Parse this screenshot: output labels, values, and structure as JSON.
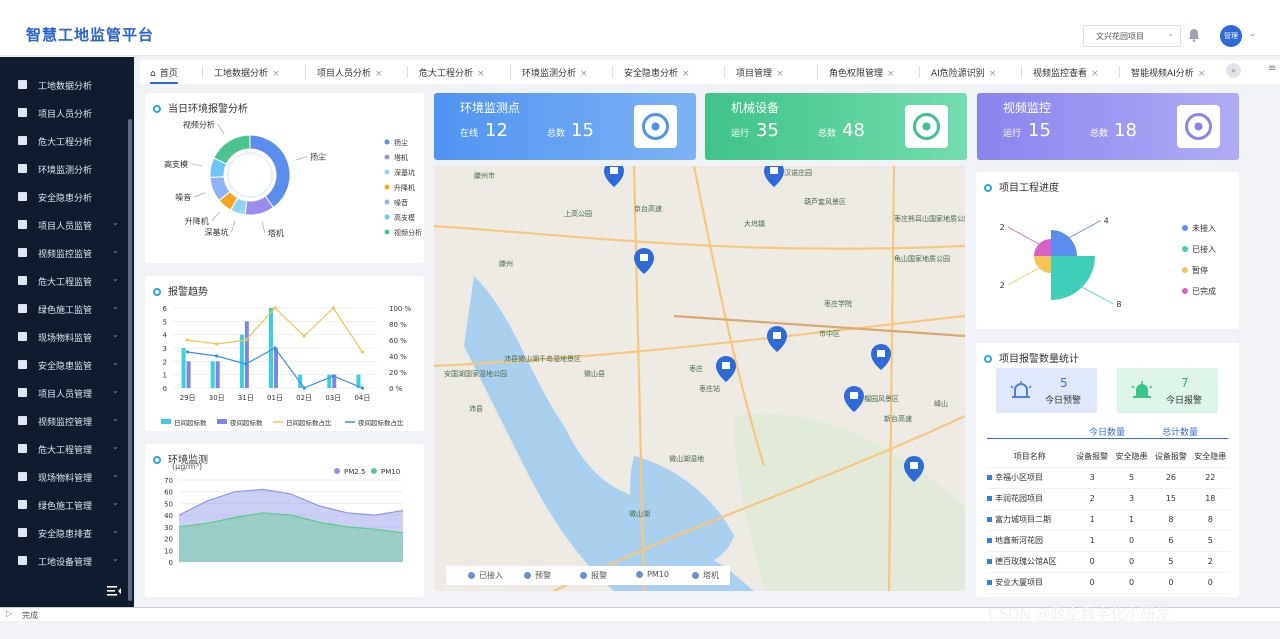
{
  "header": {
    "title": "智慧工地监管平台",
    "project_select": "文兴花园项目",
    "user": "管理"
  },
  "sidebar": {
    "items": [
      {
        "label": "工地数据分析",
        "expandable": false
      },
      {
        "label": "项目人员分析",
        "expandable": false
      },
      {
        "label": "危大工程分析",
        "expandable": false
      },
      {
        "label": "环境监测分析",
        "expandable": false
      },
      {
        "label": "安全隐患分析",
        "expandable": false
      },
      {
        "label": "项目人员监管",
        "expandable": true
      },
      {
        "label": "视频监控监管",
        "expandable": true
      },
      {
        "label": "危大工程监管",
        "expandable": true
      },
      {
        "label": "绿色施工监管",
        "expandable": true
      },
      {
        "label": "现场物料监管",
        "expandable": true
      },
      {
        "label": "安全隐患监管",
        "expandable": true
      },
      {
        "label": "项目人员管理",
        "expandable": true
      },
      {
        "label": "视频监控管理",
        "expandable": true
      },
      {
        "label": "危大工程管理",
        "expandable": true
      },
      {
        "label": "现场物料管理",
        "expandable": true
      },
      {
        "label": "绿色施工管理",
        "expandable": true
      },
      {
        "label": "安全隐患排查",
        "expandable": true
      },
      {
        "label": "工地设备管理",
        "expandable": true
      }
    ]
  },
  "tabs": [
    {
      "label": "首页",
      "active": true
    },
    {
      "label": "工地数据分析"
    },
    {
      "label": "项目人员分析"
    },
    {
      "label": "危大工程分析"
    },
    {
      "label": "环境监测分析"
    },
    {
      "label": "安全隐患分析"
    },
    {
      "label": "项目管理"
    },
    {
      "label": "角色权限管理"
    },
    {
      "label": "AI危险源识别"
    },
    {
      "label": "视频监控查看"
    },
    {
      "label": "智能视频AI分析"
    }
  ],
  "tab_more": "»",
  "alarm_analysis": {
    "title": "当日环境报警分析",
    "chart_data": {
      "type": "pie",
      "categories": [
        "扬尘",
        "塔机",
        "深基坑",
        "升降机",
        "噪音",
        "高支模",
        "视频分析"
      ],
      "values": [
        40,
        12,
        6,
        6,
        10,
        8,
        18
      ],
      "colors": [
        "#5b8def",
        "#9b8cf0",
        "#8fd3f5",
        "#f5a623",
        "#8fb3f7",
        "#6ec4f5",
        "#4cc48f"
      ]
    }
  },
  "alarm_trend": {
    "title": "报警趋势",
    "chart_data": {
      "type": "bar",
      "categories": [
        "29日",
        "30日",
        "31日",
        "01日",
        "02日",
        "03日",
        "04日"
      ],
      "yticks_left": [
        "0",
        "1",
        "2",
        "3",
        "4",
        "5",
        "6"
      ],
      "yticks_right": [
        "0 %",
        "20 %",
        "40 %",
        "60 %",
        "80 %",
        "100 %"
      ],
      "ylim": [
        0,
        6
      ],
      "series": [
        {
          "name": "日间超标数",
          "values": [
            3,
            2,
            4,
            6,
            1,
            1,
            1
          ],
          "color": "#3bd0e0"
        },
        {
          "name": "夜间超标数",
          "values": [
            2,
            2,
            5,
            3,
            0,
            1,
            0
          ],
          "color": "#7b87e8"
        },
        {
          "name": "日间超标数占比",
          "values": [
            60,
            55,
            60,
            100,
            65,
            100,
            45
          ],
          "color": "#f5c451",
          "axis": "right"
        },
        {
          "name": "夜间超标数占比",
          "values": [
            45,
            40,
            30,
            50,
            0,
            15,
            0
          ],
          "color": "#3b8ee8",
          "axis": "right"
        }
      ]
    }
  },
  "env_monitor": {
    "title": "环境监测",
    "unit": "(μg/m³)",
    "chart_data": {
      "type": "area",
      "x": [
        0,
        1,
        2,
        3,
        4,
        5,
        6,
        7,
        8
      ],
      "yticks": [
        "0",
        "10",
        "20",
        "30",
        "40",
        "50",
        "60",
        "70"
      ],
      "ylim": [
        0,
        70
      ],
      "series": [
        {
          "name": "PM2.5",
          "values": [
            40,
            52,
            60,
            62,
            58,
            48,
            42,
            40,
            44
          ],
          "color": "#8f94e8"
        },
        {
          "name": "PM10",
          "values": [
            30,
            33,
            38,
            42,
            40,
            34,
            30,
            28,
            25
          ],
          "color": "#5cc98f"
        }
      ]
    }
  },
  "cards": [
    {
      "title": "环境监测点",
      "k1": "在线",
      "v1": "12",
      "k2": "总数",
      "v2": "15",
      "color": "#4f93f0",
      "color2": "#7db3f5",
      "icon": "leaf-icon"
    },
    {
      "title": "机械设备",
      "k1": "运行",
      "v1": "35",
      "k2": "总数",
      "v2": "48",
      "color": "#3fc38a",
      "color2": "#74dcae",
      "icon": "spray-icon"
    },
    {
      "title": "视频监控",
      "k1": "运行",
      "v1": "15",
      "k2": "总数",
      "v2": "18",
      "color": "#8a84ee",
      "color2": "#b1acf5",
      "icon": "camera-icon"
    }
  ],
  "map": {
    "labels": [
      "汉诺庄园",
      "葫芦套风景区",
      "滕州市",
      "枣庄熊耳山国家地质公园",
      "龟山国家地质公园",
      "上高公园",
      "滕州",
      "京台高速",
      "大坞镇",
      "微山县",
      "枣庄",
      "枣庄学院",
      "市中区",
      "沛县",
      "微山湖",
      "新台高速",
      "榴园风景区",
      "枣庄站",
      "安国湖国家湿地公园",
      "沛县微山湖千岛湿地景区",
      "微山湖湿地",
      "峄山"
    ],
    "legend": [
      "已接入",
      "预警",
      "报警",
      "PM10",
      "塔机"
    ]
  },
  "progress": {
    "title": "项目工程进度",
    "chart_data": {
      "type": "pie",
      "categories": [
        "未接入",
        "已接入",
        "暂停",
        "已完成"
      ],
      "values": [
        4,
        8,
        2,
        2
      ],
      "colors": [
        "#5b8def",
        "#3fcfb8",
        "#f5c451",
        "#d860c8"
      ]
    }
  },
  "alarm_stats": {
    "title": "项目报警数量统计",
    "today_warn_value": "5",
    "today_warn_label": "今日预警",
    "today_alarm_value": "7",
    "today_alarm_label": "今日报警",
    "tab_today": "今日数量",
    "tab_total": "总计数量",
    "columns": [
      "项目名称",
      "设备报警",
      "安全隐患",
      "设备报警",
      "安全隐患"
    ],
    "rows": [
      [
        "幸福小区项目",
        "3",
        "5",
        "26",
        "22"
      ],
      [
        "丰润花园项目",
        "2",
        "3",
        "15",
        "18"
      ],
      [
        "富力城项目二期",
        "1",
        "1",
        "8",
        "8"
      ],
      [
        "地鑫新河花园",
        "1",
        "0",
        "6",
        "5"
      ],
      [
        "德百玫瑰公馆A区",
        "0",
        "0",
        "5",
        "2"
      ],
      [
        "安业大厦项目",
        "0",
        "0",
        "0",
        "0"
      ]
    ]
  },
  "status": "完成",
  "watermark": "CSDN @政企数字化小研发"
}
